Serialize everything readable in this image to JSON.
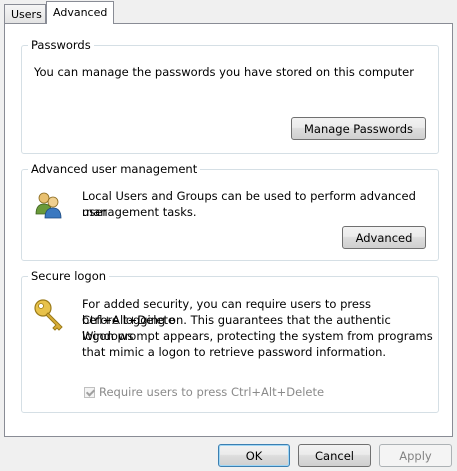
{
  "tabs": [
    {
      "label": "Users"
    },
    {
      "label": "Advanced"
    }
  ],
  "passwords": {
    "title": "Passwords",
    "description": "You can manage the passwords you have stored on this computer",
    "button_label": "Manage Passwords"
  },
  "user_management": {
    "title": "Advanced user management",
    "description_line1": "Local Users and Groups can be used to perform advanced user",
    "description_line2": "management tasks.",
    "button_label": "Advanced",
    "icon": "users-icon"
  },
  "secure_logon": {
    "title": "Secure logon",
    "lines": [
      "For added security, you can require users to press Ctrl+Alt+Delete",
      "before logging on. This guarantees that the authentic Windows",
      "logon prompt appears, protecting the system from programs",
      "that mimic a logon to retrieve password information."
    ],
    "checkbox_label": "Require users to press Ctrl+Alt+Delete",
    "checkbox_checked": true,
    "checkbox_disabled": true,
    "icon": "key-icon"
  },
  "footer": {
    "ok_label": "OK",
    "cancel_label": "Cancel",
    "apply_label": "Apply"
  }
}
